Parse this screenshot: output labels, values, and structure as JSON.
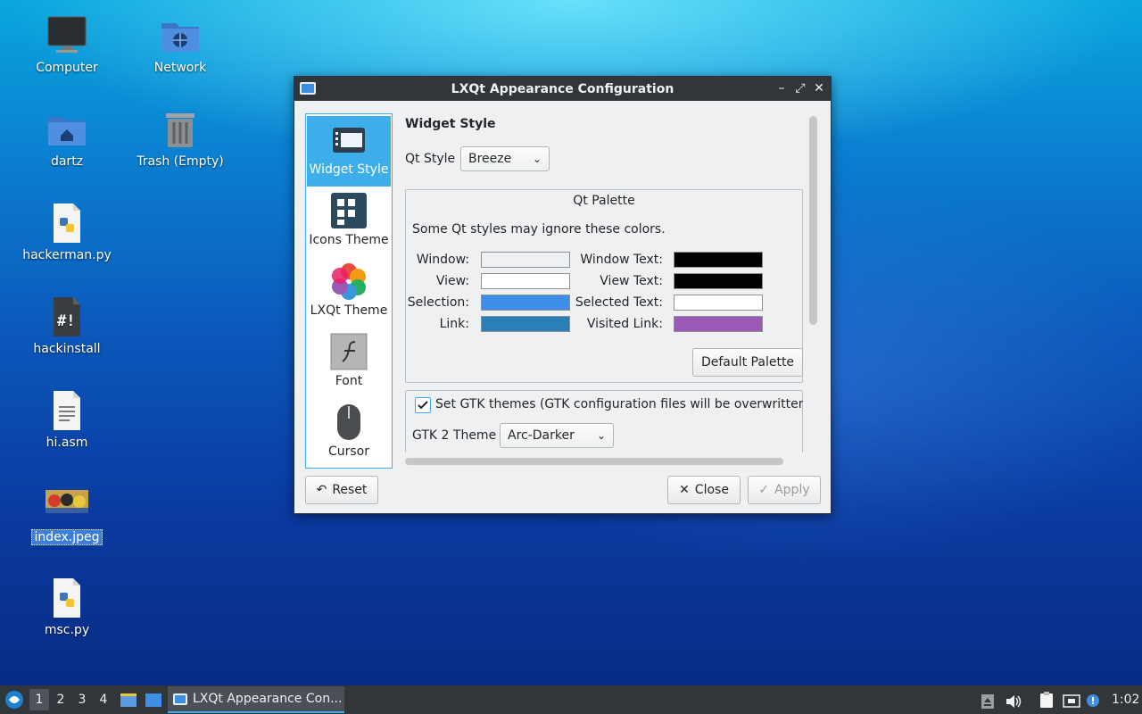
{
  "desktop": {
    "icons": [
      {
        "label": "Computer",
        "icon": "computer-icon"
      },
      {
        "label": "Network",
        "icon": "network-folder-icon"
      },
      {
        "label": "dartz",
        "icon": "home-folder-icon"
      },
      {
        "label": "Trash (Empty)",
        "icon": "trash-icon"
      },
      {
        "label": "hackerman.py",
        "icon": "python-file-icon"
      },
      {
        "label": "hackinstall",
        "icon": "shell-script-icon"
      },
      {
        "label": "hi.asm",
        "icon": "text-file-icon"
      },
      {
        "label": "index.jpeg",
        "icon": "image-file-icon",
        "selected": true
      },
      {
        "label": "msc.py",
        "icon": "python-file-icon"
      }
    ]
  },
  "window": {
    "title": "LXQt Appearance Configuration",
    "controls": {
      "minimize": "–",
      "maximize": "⤢",
      "close": "✕"
    },
    "sidebar": [
      {
        "label": "Widget Style",
        "icon": "widget-style-icon",
        "active": true
      },
      {
        "label": "Icons Theme",
        "icon": "icons-theme-icon"
      },
      {
        "label": "LXQt Theme",
        "icon": "lxqt-theme-icon"
      },
      {
        "label": "Font",
        "icon": "font-icon"
      },
      {
        "label": "Cursor",
        "icon": "cursor-icon"
      }
    ],
    "panel": {
      "heading": "Widget Style",
      "qt_style_label": "Qt Style",
      "qt_style_value": "Breeze",
      "palette": {
        "title": "Qt Palette",
        "note": "Some Qt styles may ignore these colors.",
        "window_label": "Window:",
        "window_text_label": "Window Text:",
        "view_label": "View:",
        "view_text_label": "View Text:",
        "selection_label": "Selection:",
        "selected_text_label": "Selected Text:",
        "link_label": "Link:",
        "visited_link_label": "Visited Link:",
        "colors": {
          "window": "#eff0f1",
          "window_text": "#000000",
          "view": "#ffffff",
          "view_text": "#000000",
          "selection": "#3d8ee6",
          "selected_text": "#ffffff",
          "link": "#2980b9",
          "visited_link": "#9b59b6"
        },
        "default_button": "Default Palette"
      },
      "gtk_checkbox_label": "Set GTK themes (GTK configuration files will be overwritten!)",
      "gtk_checked": true,
      "gtk2_label": "GTK 2 Theme",
      "gtk2_value": "Arc-Darker"
    },
    "buttons": {
      "reset": "Reset",
      "close": "Close",
      "apply": "Apply"
    }
  },
  "taskbar": {
    "desktops": [
      "1",
      "2",
      "3",
      "4"
    ],
    "active_task": "LXQt Appearance Con...",
    "clock": "1:02"
  }
}
